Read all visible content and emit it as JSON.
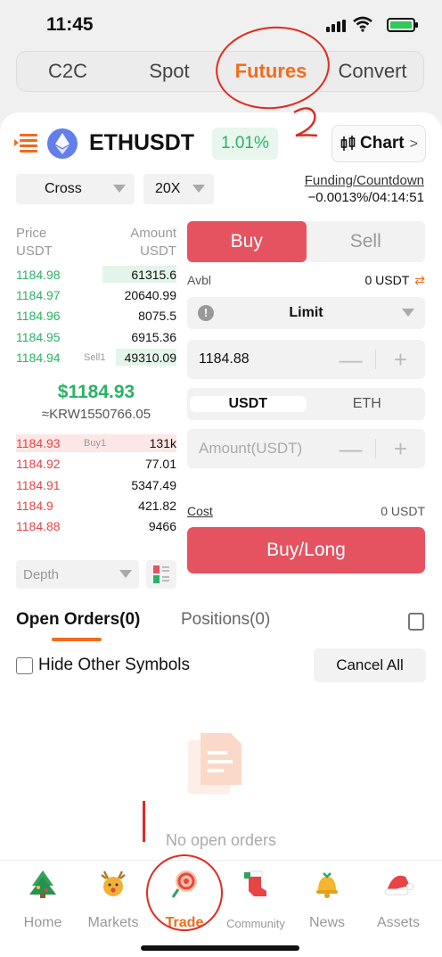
{
  "status": {
    "time": "11:45"
  },
  "top_tabs": [
    {
      "label": "C2C",
      "active": false
    },
    {
      "label": "Spot",
      "active": false
    },
    {
      "label": "Futures",
      "active": true
    },
    {
      "label": "Convert",
      "active": false
    }
  ],
  "header": {
    "pair": "ETHUSDT",
    "change": "1.01%",
    "chart_label": "Chart",
    "chart_chevron": ">"
  },
  "controls": {
    "margin_mode": "Cross",
    "leverage": "20X"
  },
  "funding": {
    "title": "Funding/Countdown",
    "value": "−0.0013%/04:14:51"
  },
  "orderbook": {
    "price_header": "Price\nUSDT",
    "amount_header": "Amount\nUSDT",
    "asks": [
      {
        "price": "1184.98",
        "amount": "61315.6",
        "tag": "",
        "depth": 0.46
      },
      {
        "price": "1184.97",
        "amount": "20640.99",
        "tag": "",
        "depth": 0.0
      },
      {
        "price": "1184.96",
        "amount": "8075.5",
        "tag": "",
        "depth": 0.0
      },
      {
        "price": "1184.95",
        "amount": "6915.36",
        "tag": "",
        "depth": 0.0
      },
      {
        "price": "1184.94",
        "amount": "49310.09",
        "tag": "Sell1",
        "depth": 0.38
      }
    ],
    "last_price": "$1184.93",
    "krw_price": "≈KRW1550766.05",
    "bids": [
      {
        "price": "1184.93",
        "amount": "131k",
        "tag": "Buy1",
        "depth": 1.0
      },
      {
        "price": "1184.92",
        "amount": "77.01",
        "tag": "",
        "depth": 0.0
      },
      {
        "price": "1184.91",
        "amount": "5347.49",
        "tag": "",
        "depth": 0.0
      },
      {
        "price": "1184.9",
        "amount": "421.82",
        "tag": "",
        "depth": 0.0
      },
      {
        "price": "1184.88",
        "amount": "9466",
        "tag": "",
        "depth": 0.0
      }
    ],
    "depth_label": "Depth"
  },
  "form": {
    "buy_label": "Buy",
    "sell_label": "Sell",
    "avbl_label": "Avbl",
    "avbl_value": "0 USDT",
    "order_type": "Limit",
    "price_value": "1184.88",
    "unit_usdt": "USDT",
    "unit_eth": "ETH",
    "amount_placeholder": "Amount(USDT)",
    "cost_label": "Cost",
    "cost_value": "0 USDT",
    "submit_label": "Buy/Long"
  },
  "orders": {
    "tab_open": "Open Orders(0)",
    "tab_positions": "Positions(0)",
    "hide_label": "Hide Other Symbols",
    "cancel_all": "Cancel All",
    "empty_text": "No open orders"
  },
  "nav": [
    {
      "label": "Home",
      "icon": "home-tree-icon",
      "active": false
    },
    {
      "label": "Markets",
      "icon": "markets-reindeer-icon",
      "active": false
    },
    {
      "label": "Trade",
      "icon": "trade-lollipop-icon",
      "active": true
    },
    {
      "label": "Community",
      "icon": "community-stocking-icon",
      "active": false
    },
    {
      "label": "News",
      "icon": "news-bell-icon",
      "active": false
    },
    {
      "label": "Assets",
      "icon": "assets-santa-hat-icon",
      "active": false
    }
  ],
  "colors": {
    "accent": "#f26b1d",
    "up": "#2bb265",
    "down": "#e64545",
    "buy_button": "#e55361",
    "annotation": "#e02b1d"
  }
}
